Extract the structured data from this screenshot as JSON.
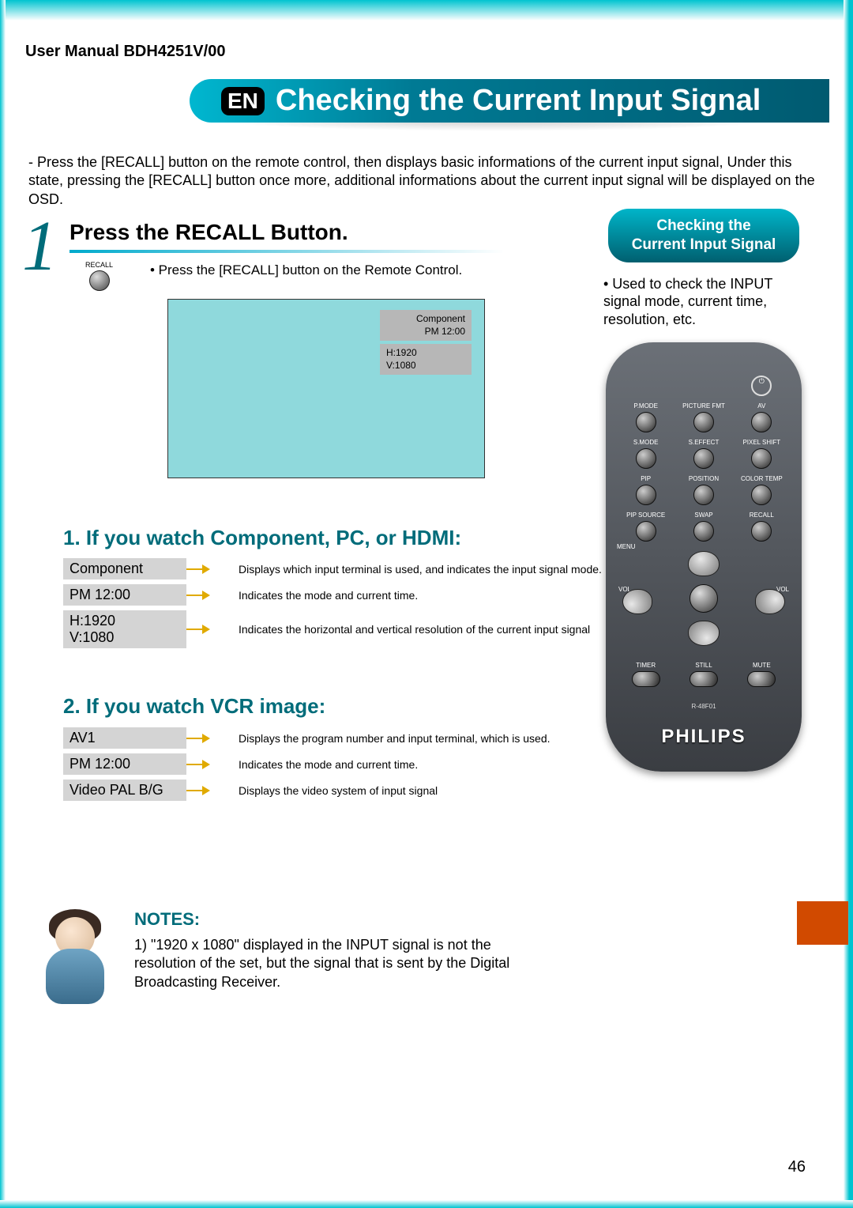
{
  "manual_id": "User Manual BDH4251V/00",
  "en_badge": "EN",
  "page_title": "Checking the Current Input Signal",
  "intro": "- Press the [RECALL] button on the remote control, then displays basic informations of the current input signal, Under this state, pressing the [RECALL] button once more, additional informations about the current input signal will be displayed on the OSD.",
  "step_number": "1",
  "step_heading": "Press the RECALL Button.",
  "recall_label": "RECALL",
  "step_instruction": "• Press the [RECALL] button on the Remote Control.",
  "osd_top": {
    "line1": "Component",
    "line2": "PM 12:00"
  },
  "osd_bottom": {
    "line1": "H:1920",
    "line2": "V:1080"
  },
  "section1_heading": "1. If you watch Component, PC, or HDMI:",
  "section1_rows": [
    {
      "chip": "Component",
      "desc": "Displays which input terminal is used, and indicates the input signal mode."
    },
    {
      "chip": "PM 12:00",
      "desc": "Indicates the mode and current time."
    },
    {
      "chip": "H:1920\nV:1080",
      "desc": "Indicates the horizontal and vertical resolution of the current input signal"
    }
  ],
  "section2_heading": "2. If you watch VCR image:",
  "section2_rows": [
    {
      "chip": "AV1",
      "desc": "Displays the program number and input terminal, which is used."
    },
    {
      "chip": "PM 12:00",
      "desc": "Indicates the mode and current time."
    },
    {
      "chip": "Video PAL B/G",
      "desc": "Displays the video system of input signal"
    }
  ],
  "sidebar": {
    "badge_line1": "Checking the",
    "badge_line2": "Current Input Signal",
    "desc": "• Used to check the INPUT signal mode, current time, resolution, etc."
  },
  "remote": {
    "row1": [
      "P.MODE",
      "PICTURE FMT",
      "AV"
    ],
    "row2": [
      "S.MODE",
      "S.EFFECT",
      "PIXEL SHIFT"
    ],
    "row3": [
      "PIP",
      "POSITION",
      "COLOR TEMP"
    ],
    "row4": [
      "PIP SOURCE",
      "SWAP",
      "RECALL"
    ],
    "menu_label": "MENU",
    "vol_label": "VOL",
    "bottom": [
      "TIMER",
      "STILL",
      "MUTE"
    ],
    "model": "R-48F01",
    "brand": "PHILIPS"
  },
  "notes_title": "NOTES:",
  "notes_text": "1)  \"1920 x 1080\" displayed in the INPUT  signal is not the resolution of the set, but the signal that is sent by the Digital Broadcasting Receiver.",
  "page_number": "46"
}
